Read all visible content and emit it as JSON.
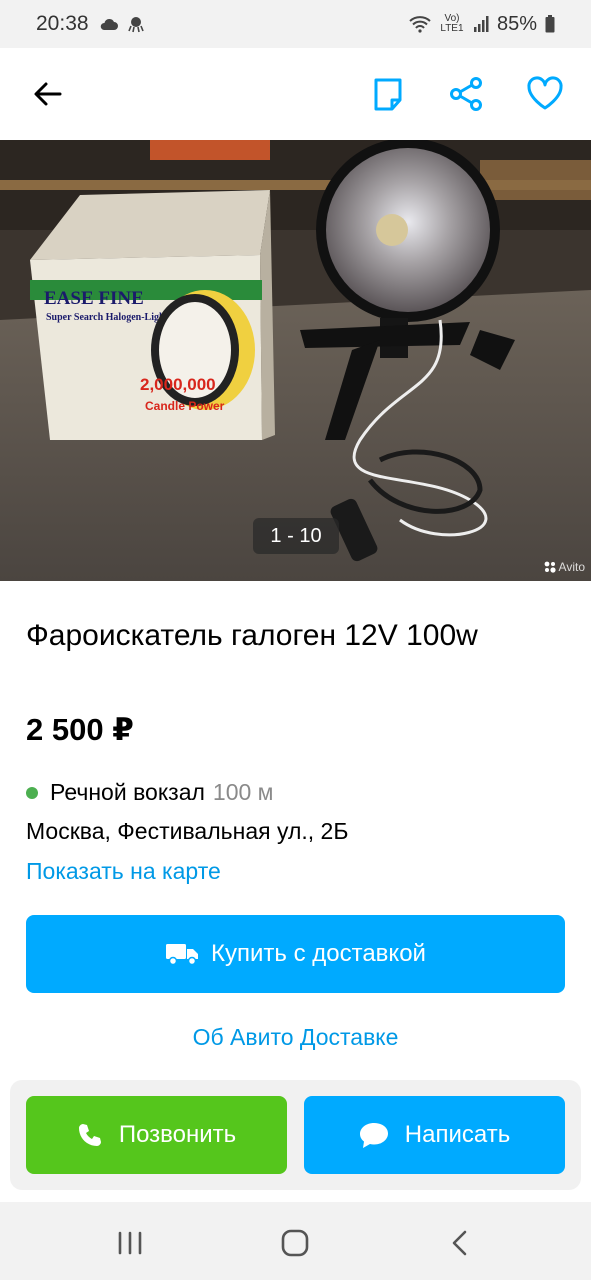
{
  "status_bar": {
    "time": "20:38",
    "battery": "85%",
    "network": "Vo) LTE1"
  },
  "toolbar": {
    "back_icon": "arrow-left-icon",
    "notes_icon": "note-icon",
    "share_icon": "share-icon",
    "favorite_icon": "heart-icon"
  },
  "gallery": {
    "counter": "1 - 10",
    "watermark": "Avito",
    "box_brand": "EASE FINE",
    "box_subtitle": "Super Search Halogen-Light",
    "box_power": "2,000,000",
    "box_power2": "Candle Power"
  },
  "listing": {
    "title": "Фароискатель галоген 12V 100w",
    "price": "2 500 ₽",
    "metro_station": "Речной вокзал",
    "metro_distance": "100 м",
    "address": "Москва, Фестивальная ул., 2Б",
    "map_link": "Показать на карте"
  },
  "actions": {
    "buy_label": "Купить с доставкой",
    "about_delivery": "Об Авито Доставке",
    "call_label": "Позвонить",
    "message_label": "Написать"
  },
  "colors": {
    "accent_blue": "#00aaff",
    "link_blue": "#0099e6",
    "call_green": "#55c61c",
    "metro_green": "#4caf50"
  }
}
